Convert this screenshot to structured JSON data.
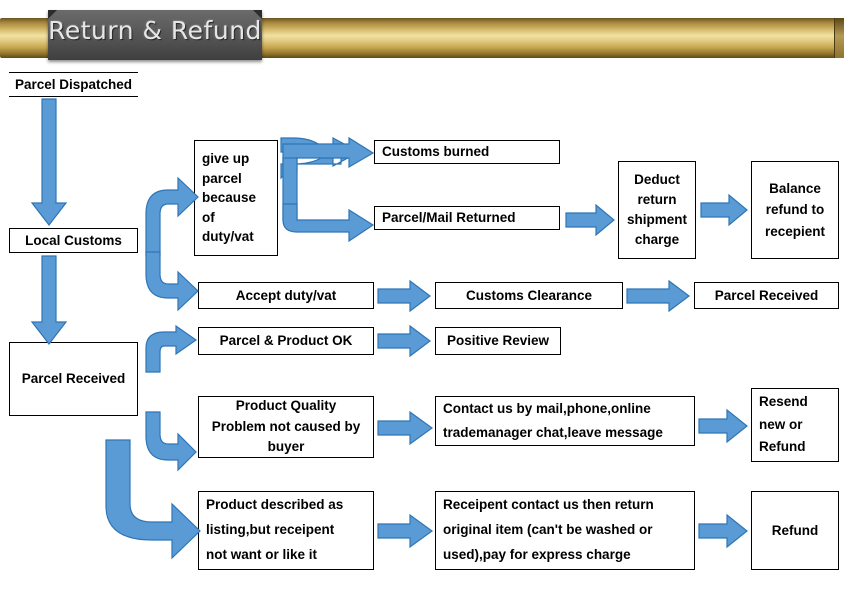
{
  "banner": {
    "title": "Return & Refund",
    "gold_color": "#d7bd6d",
    "plaque_color": "#555555",
    "title_color": "#e6e6e6"
  },
  "theme": {
    "arrow_fill": "#5b9bd5",
    "arrow_stroke": "#2e75b6",
    "box_border": "#000000",
    "box_fill": "#ffffff",
    "text_color": "#000000",
    "page_background": "#ffffff"
  },
  "flowchart": {
    "type": "diagram",
    "title": "Return & Refund",
    "nodes": [
      {
        "id": "parcel-dispatched",
        "label": "Parcel Dispatched"
      },
      {
        "id": "local-customs",
        "label": "Local Customs"
      },
      {
        "id": "give-up-parcel",
        "label": "give up\nparcel\nbecause\nof\nduty/vat"
      },
      {
        "id": "customs-burned",
        "label": "Customs burned"
      },
      {
        "id": "parcel-mail-returned",
        "label": "Parcel/Mail Returned"
      },
      {
        "id": "deduct-return-shipment-charge",
        "label": "Deduct\nreturn\nshipment\ncharge"
      },
      {
        "id": "balance-refund",
        "label": "Balance\nrefund to\nrecepient"
      },
      {
        "id": "accept-duty-vat",
        "label": "Accept duty/vat"
      },
      {
        "id": "customs-clearance",
        "label": "Customs Clearance"
      },
      {
        "id": "parcel-received-right",
        "label": "Parcel Received"
      },
      {
        "id": "parcel-received",
        "label": "Parcel Received"
      },
      {
        "id": "parcel-product-ok",
        "label": "Parcel & Product OK"
      },
      {
        "id": "positive-review",
        "label": "Positive Review"
      },
      {
        "id": "product-quality-problem",
        "label": "Product Quality\nProblem not caused by\nbuyer"
      },
      {
        "id": "contact-us",
        "label": "Contact us by mail,phone,online\ntrademanager chat,leave message"
      },
      {
        "id": "resend-or-refund",
        "label": "Resend\nnew or\nRefund"
      },
      {
        "id": "product-described",
        "label": "Product described as\nlisting,but receipent\nnot want or like it"
      },
      {
        "id": "receipent-return",
        "label": "Receipent contact us then return\noriginal item (can't be washed or\nused),pay for express charge"
      },
      {
        "id": "refund",
        "label": "Refund"
      }
    ],
    "node_labels": {
      "parcel_dispatched": "Parcel Dispatched",
      "local_customs": "Local Customs",
      "give_up_parcel_l1": "give up",
      "give_up_parcel_l2": "parcel",
      "give_up_parcel_l3": "because",
      "give_up_parcel_l4": "of",
      "give_up_parcel_l5": "duty/vat",
      "customs_burned": "Customs burned",
      "parcel_mail_returned": "Parcel/Mail Returned",
      "deduct_l1": "Deduct",
      "deduct_l2": "return",
      "deduct_l3": "shipment",
      "deduct_l4": "charge",
      "balance_l1": "Balance",
      "balance_l2": "refund to",
      "balance_l3": "recepient",
      "accept_duty_vat": "Accept duty/vat",
      "customs_clearance": "Customs Clearance",
      "parcel_received_right": "Parcel Received",
      "parcel_received": "Parcel Received",
      "parcel_product_ok": "Parcel & Product OK",
      "positive_review": "Positive Review",
      "quality_l1": "Product Quality",
      "quality_l2": "Problem not caused by",
      "quality_l3": "buyer",
      "contact_l1": "Contact us by mail,phone,online",
      "contact_l2": "trademanager chat,leave message",
      "resend_l1": "Resend",
      "resend_l2": "new or",
      "resend_l3": "Refund",
      "described_l1": "Product described as",
      "described_l2": "listing,but receipent",
      "described_l3": "not want or like it",
      "receipent_l1": "Receipent contact us then return",
      "receipent_l2": "original item (can't be washed or",
      "receipent_l3": "used),pay for express charge",
      "refund": "Refund"
    },
    "edges": [
      {
        "from": "parcel-dispatched",
        "to": "local-customs",
        "style": "straight-down"
      },
      {
        "from": "local-customs",
        "to": "give-up-parcel",
        "style": "curved-up-right"
      },
      {
        "from": "local-customs",
        "to": "accept-duty-vat",
        "style": "curved-down-right"
      },
      {
        "from": "local-customs",
        "to": "parcel-received",
        "style": "straight-down"
      },
      {
        "from": "give-up-parcel",
        "to": "customs-burned",
        "style": "split-up-right"
      },
      {
        "from": "give-up-parcel",
        "to": "parcel-mail-returned",
        "style": "split-down-right"
      },
      {
        "from": "parcel-mail-returned",
        "to": "deduct-return-shipment-charge",
        "style": "straight-right"
      },
      {
        "from": "deduct-return-shipment-charge",
        "to": "balance-refund",
        "style": "straight-right"
      },
      {
        "from": "accept-duty-vat",
        "to": "customs-clearance",
        "style": "straight-right"
      },
      {
        "from": "customs-clearance",
        "to": "parcel-received-right",
        "style": "straight-right"
      },
      {
        "from": "parcel-received",
        "to": "parcel-product-ok",
        "style": "curved-up-right"
      },
      {
        "from": "parcel-received",
        "to": "product-quality-problem",
        "style": "curved-down-right"
      },
      {
        "from": "parcel-received",
        "to": "product-described",
        "style": "curved-down-right-long"
      },
      {
        "from": "parcel-product-ok",
        "to": "positive-review",
        "style": "straight-right"
      },
      {
        "from": "product-quality-problem",
        "to": "contact-us",
        "style": "straight-right"
      },
      {
        "from": "contact-us",
        "to": "resend-or-refund",
        "style": "straight-right"
      },
      {
        "from": "product-described",
        "to": "receipent-return",
        "style": "straight-right"
      },
      {
        "from": "receipent-return",
        "to": "refund",
        "style": "straight-right"
      }
    ]
  }
}
